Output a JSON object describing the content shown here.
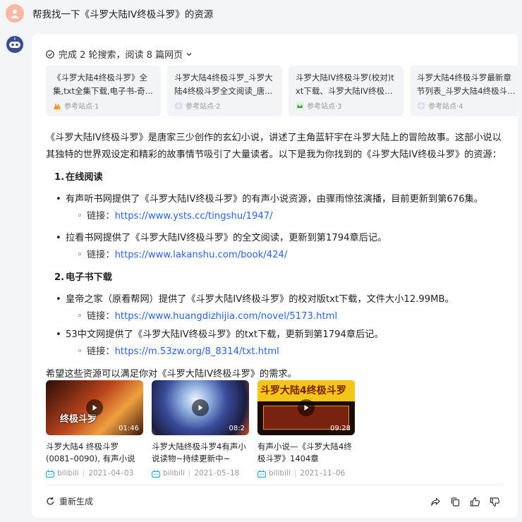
{
  "user_message": "帮我找一下《斗罗大陆IV终极斗罗》的资源",
  "search_status": "完成 2 轮搜索，阅读 8 篇网页",
  "references": [
    {
      "title": "《斗罗大陆4终极斗罗》全集,txt全集下载,电子书-奇...",
      "source": "参考站点·1"
    },
    {
      "title": "斗罗大陆4终极斗罗_斗罗大陆4终极斗罗全文阅读_唐...",
      "source": "参考站点·2"
    },
    {
      "title": "斗罗大陆IV终极斗罗(校对)txt下载、斗罗大陆IV终极斗...",
      "source": "参考站点·3"
    },
    {
      "title": "斗罗大陆4终极斗罗最新章节列表_斗罗大陆4终极斗罗...",
      "source": "参考站点·4"
    }
  ],
  "answer": {
    "intro": "《斗罗大陆IV终极斗罗》是唐家三少创作的玄幻小说，讲述了主角蓝轩宇在斗罗大陆上的冒险故事。这部小说以其独特的世界观设定和精彩的故事情节吸引了大量读者。以下是我为你找到的《斗罗大陆IV终极斗罗》的资源：",
    "section1": {
      "num": "1.",
      "title": "在线阅读"
    },
    "item1": "有声听书网提供了《斗罗大陆IV终极斗罗》的有声小说资源，由骤雨惊弦演播，目前更新到第676集。",
    "link_label": "链接：",
    "item1_link": "https://www.ysts.cc/tingshu/1947/",
    "item2": "拉看书网提供了《斗罗大陆IV终极斗罗》的全文阅读，更新到第1794章后记。",
    "item2_link": "https://www.lakanshu.com/book/424/",
    "section2": {
      "num": "2.",
      "title": "电子书下载"
    },
    "item3": "皇帝之家（原看帮网）提供了《斗罗大陆IV终极斗罗》的校对版txt下载，文件大小12.99MB。",
    "item3_link": "https://www.huangdizhijia.com/novel/5173.html",
    "item4": "53中文网提供了《斗罗大陆IV终极斗罗》的txt下载，更新到第1794章后记。",
    "item4_link": "https://m.53zw.org/8_8314/txt.html",
    "outro": "希望这些资源可以满足你对《斗罗大陆IV终极斗罗》的需求。"
  },
  "videos": [
    {
      "title": "斗罗大陆4 终极斗罗(0081–0090), 有声小说",
      "duration": "01:46",
      "platform": "bilibili",
      "date": "2021–04–03",
      "overlay": "终极斗罗"
    },
    {
      "title": "斗罗大陆终极斗罗4有声小说读物~持续更新中~",
      "duration": "08:2",
      "platform": "bilibili",
      "date": "2021–05–18"
    },
    {
      "title": "有声小说—《斗罗大陆4终极斗罗》1404章",
      "duration": "09:28",
      "platform": "bilibili",
      "date": "2021–11–06",
      "overlay": "斗罗大陆4终极斗罗"
    }
  ],
  "regenerate_label": "重新生成",
  "colors": {
    "link": "#2a63d6",
    "card_bg": "#ffffff",
    "page_bg": "#f4f5f7"
  }
}
